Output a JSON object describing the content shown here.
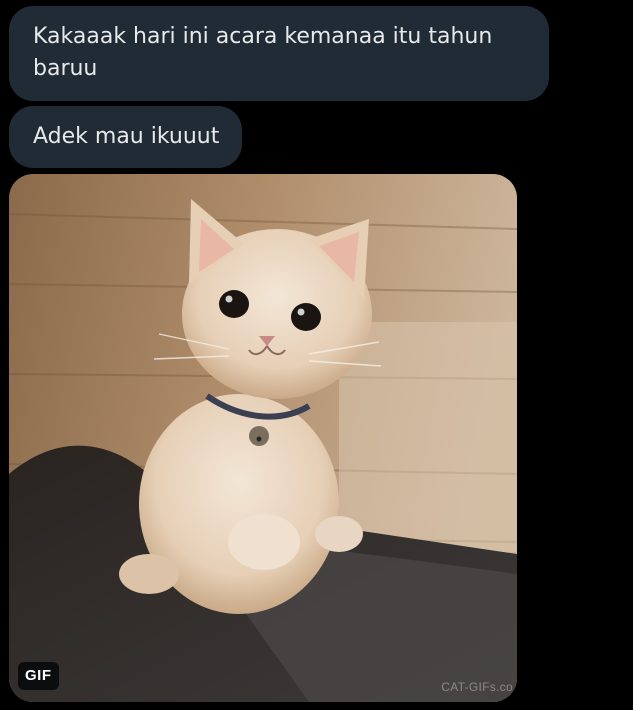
{
  "messages": [
    {
      "text": "Kakaaak hari ini acara kemanaa itu tahun baruu"
    },
    {
      "text": "Adek mau ikuuut"
    }
  ],
  "gif": {
    "badge": "GIF",
    "watermark": "CAT-GIFs.co",
    "subject": "kitten-peeking-over-bed"
  },
  "colors": {
    "background": "#000000",
    "bubble": "#202b36",
    "bubble_text": "#e7e9ea",
    "badge_bg": "#0b0d0f",
    "badge_text": "#ffffff"
  }
}
